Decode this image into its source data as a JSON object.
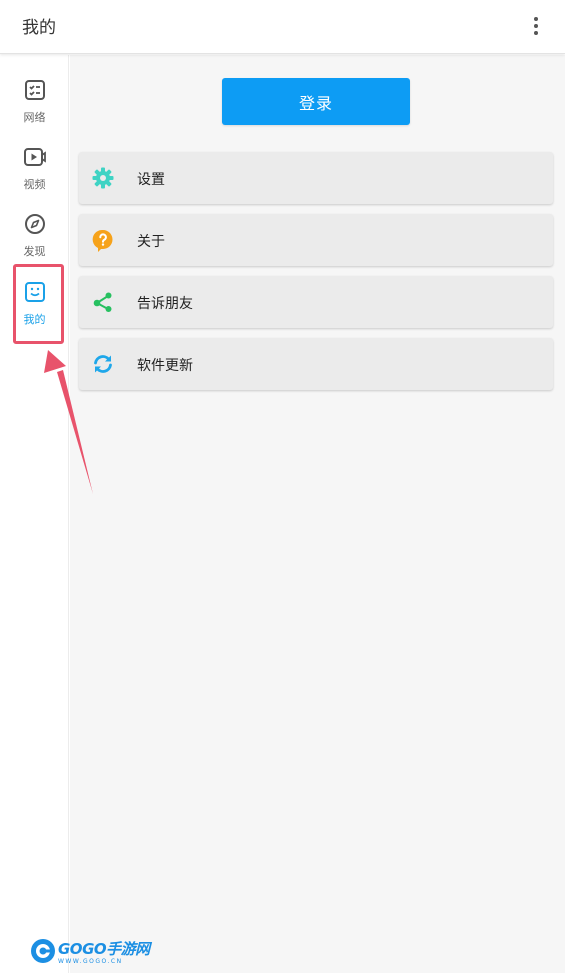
{
  "appbar": {
    "title": "我的",
    "overflow_icon": "more-vert-icon"
  },
  "sidebar": {
    "items": [
      {
        "label": "网络",
        "icon": "network-list-icon",
        "active": false
      },
      {
        "label": "视频",
        "icon": "video-icon",
        "active": false
      },
      {
        "label": "发现",
        "icon": "compass-icon",
        "active": false
      },
      {
        "label": "我的",
        "icon": "smile-face-icon",
        "active": true
      }
    ]
  },
  "main": {
    "login_label": "登录",
    "menu": [
      {
        "label": "设置",
        "icon": "gear-icon",
        "color": "#3fd3c4"
      },
      {
        "label": "关于",
        "icon": "help-icon",
        "color": "#f6a21a"
      },
      {
        "label": "告诉朋友",
        "icon": "share-icon",
        "color": "#27c060"
      },
      {
        "label": "软件更新",
        "icon": "refresh-icon",
        "color": "#1ea7ea"
      }
    ]
  },
  "watermark": {
    "text": "GOGO手游网",
    "url": "WWW.GOGO.CN"
  },
  "colors": {
    "accent": "#0d9cf4",
    "active_nav": "#1aa1e8",
    "annotation": "#e8536b"
  }
}
